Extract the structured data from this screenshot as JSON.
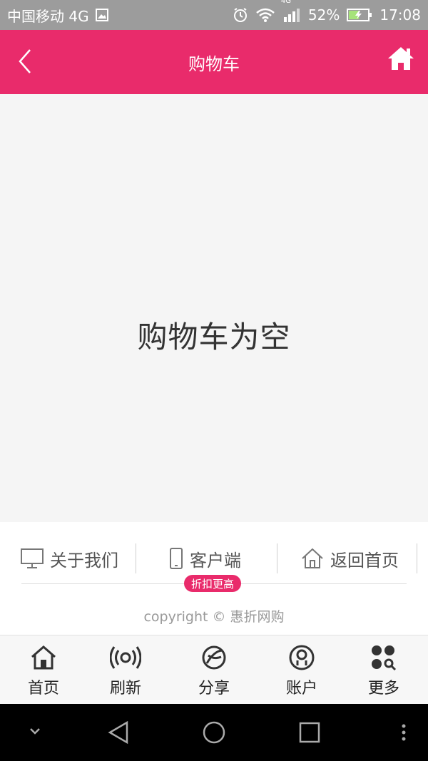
{
  "status_bar": {
    "carrier": "中国移动 4G",
    "network_badge": "4G",
    "battery": "52%",
    "time": "17:08"
  },
  "header": {
    "title": "购物车"
  },
  "main": {
    "empty_message": "购物车为空"
  },
  "footer_links": {
    "about": "关于我们",
    "client": "客户端",
    "home": "返回首页",
    "badge": "折扣更高",
    "copyright": "copyright © 惠折网购"
  },
  "tab_bar": {
    "items": [
      {
        "label": "首页",
        "icon": "home-icon"
      },
      {
        "label": "刷新",
        "icon": "refresh-icon"
      },
      {
        "label": "分享",
        "icon": "share-icon"
      },
      {
        "label": "账户",
        "icon": "account-icon"
      },
      {
        "label": "更多",
        "icon": "more-icon"
      }
    ]
  },
  "colors": {
    "brand": "#e92b6b",
    "status_bar": "#9c9c9c",
    "content_bg": "#f5f5f5"
  }
}
